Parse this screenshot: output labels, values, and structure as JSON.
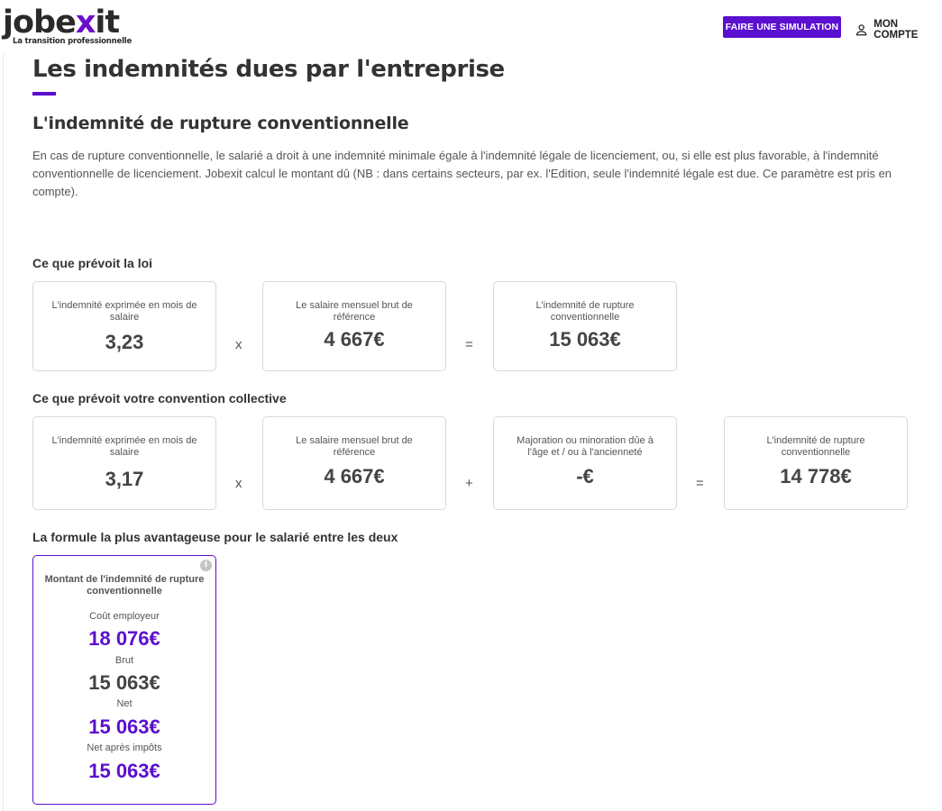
{
  "header": {
    "logo_text_1": "jobe",
    "logo_text_x": "x",
    "logo_text_2": "it",
    "logo_tagline": "La transition professionnelle",
    "simulation_button": "FAIRE UNE SIMULATION",
    "account_label": "MON COMPTE",
    "brand_color": "#5b0fcf"
  },
  "page": {
    "title": "Les indemnités dues par l'entreprise",
    "section_title": "L'indemnité de rupture conventionnelle",
    "description": "En cas de rupture conventionnelle, le salarié a droit à une indemnité minimale égale à l'indemnité légale de licenciement, ou, si elle est plus favorable, à l'indemnité conventionnelle de licenciement. Jobexit calcul le montant dû (NB : dans certains secteurs, par ex. l'Edition, seule l'indemnité légale est due. Ce paramètre est pris en compte)."
  },
  "law": {
    "heading": "Ce que prévoit la loi",
    "months_label": "L'indemnité exprimée en mois de salaire",
    "months_value": "3,23",
    "op_multiply": "x",
    "salary_label": "Le salaire mensuel brut de référence",
    "salary_value": "4 667€",
    "op_equals": "=",
    "result_label": "L'indemnité de rupture conventionnelle",
    "result_value": "15 063€"
  },
  "convention": {
    "heading": "Ce que prévoit votre convention collective",
    "months_label": "L'indemnité exprimée en mois de salaire",
    "months_value": "3,17",
    "op_multiply": "x",
    "salary_label": "Le salaire mensuel brut de référence",
    "salary_value": "4 667€",
    "op_plus": "+",
    "adjust_label": "Majoration ou minoration dûe à l'âge et / ou à l'ancienneté",
    "adjust_value": "-€",
    "op_equals": "=",
    "result_label": "L'indemnité de rupture conventionnelle",
    "result_value": "14 778€"
  },
  "best": {
    "heading": "La formule la plus avantageuse pour le salarié entre les deux",
    "info_icon": "i",
    "card_title": "Montant de l'indemnité de rupture conventionnelle",
    "employer_cost_label": "Coût employeur",
    "employer_cost_value": "18 076€",
    "gross_label": "Brut",
    "gross_value": "15 063€",
    "net_label": "Net",
    "net_value": "15 063€",
    "net_after_tax_label": "Net après impôts",
    "net_after_tax_value": "15 063€"
  }
}
